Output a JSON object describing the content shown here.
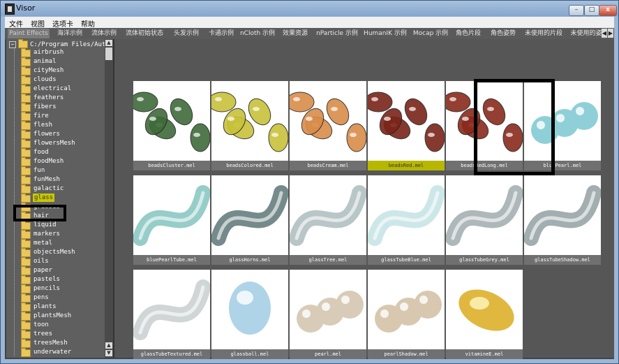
{
  "window": {
    "title": "Visor"
  },
  "menubar": [
    "文件",
    "视图",
    "选项卡",
    "帮助"
  ],
  "tabs": [
    "Paint Effects",
    "海洋示例",
    "流体示例",
    "流体初始状态",
    "头发示例",
    "卡通示例",
    "nCloth 示例",
    "效果资源",
    "nParticle 示例",
    "HumanIK 示例",
    "Mocap 示例",
    "角色片段",
    "角色姿势",
    "未使用的片段",
    "未使用的姿"
  ],
  "active_tab": "Paint Effects",
  "tree": {
    "root_path": "C:/Program Files/Autod",
    "selected": "glass",
    "items": [
      "airbrush",
      "animal",
      "cityMesh",
      "clouds",
      "electrical",
      "feathers",
      "fibers",
      "fire",
      "flesh",
      "flowers",
      "flowersMesh",
      "food",
      "foodMesh",
      "fun",
      "funMesh",
      "galactic",
      "glass",
      "grasses",
      "hair",
      "liquid",
      "markers",
      "metal",
      "objectsMesh",
      "oils",
      "paper",
      "pastels",
      "pencils",
      "pens",
      "plants",
      "plantsMesh",
      "toon",
      "trees",
      "treesMesh",
      "underwater"
    ]
  },
  "gallery": {
    "selected": "beadsRed.mel",
    "items": [
      {
        "label": "beadsCluster.mel",
        "icon": "beads-cluster-icon",
        "color": "#3f6b3a"
      },
      {
        "label": "beadsColored.mel",
        "icon": "beads-colored-icon",
        "color": "#c8c23a"
      },
      {
        "label": "beadsCream.mel",
        "icon": "beads-cream-icon",
        "color": "#d98c4a"
      },
      {
        "label": "beadsRed.mel",
        "icon": "beads-red-icon",
        "color": "#7a2418"
      },
      {
        "label": "beadsRedLong.mel",
        "icon": "beads-red-long-icon",
        "color": "#8a2a1c"
      },
      {
        "label": "bluePearl.mel",
        "icon": "blue-pearl-icon",
        "color": "#8fd0d8"
      },
      {
        "label": "bluePearlTube.mel",
        "icon": "blue-pearl-tube-icon",
        "color": "#6ab8b0"
      },
      {
        "label": "glassHorns.mel",
        "icon": "glass-horns-icon",
        "color": "#3a5a5a"
      },
      {
        "label": "glassTree.mel",
        "icon": "glass-tree-icon",
        "color": "#9aaeb0"
      },
      {
        "label": "glassTubeBlue.mel",
        "icon": "glass-tube-blue-icon",
        "color": "#b8dde0"
      },
      {
        "label": "glassTubeGrey.mel",
        "icon": "glass-tube-grey-icon",
        "color": "#8c9a9c"
      },
      {
        "label": "glassTubeShadow.mel",
        "icon": "glass-tube-shadow-icon",
        "color": "#7a8c8e"
      },
      {
        "label": "glassTubeTextured.mel",
        "icon": "glass-tube-textured-icon",
        "color": "#bcc4c4"
      },
      {
        "label": "glassball.mel",
        "icon": "glass-ball-icon",
        "color": "#7ab8d8"
      },
      {
        "label": "pearl.mel",
        "icon": "pearl-icon",
        "color": "#d8ccb8"
      },
      {
        "label": "pearlShadow.mel",
        "icon": "pearl-shadow-icon",
        "color": "#d8c8b0"
      },
      {
        "label": "vitamineE.mel",
        "icon": "vitamin-e-icon",
        "color": "#e0b840"
      }
    ]
  },
  "colors": {
    "selection": "#c8c800",
    "highlight_frame": "#000000"
  }
}
